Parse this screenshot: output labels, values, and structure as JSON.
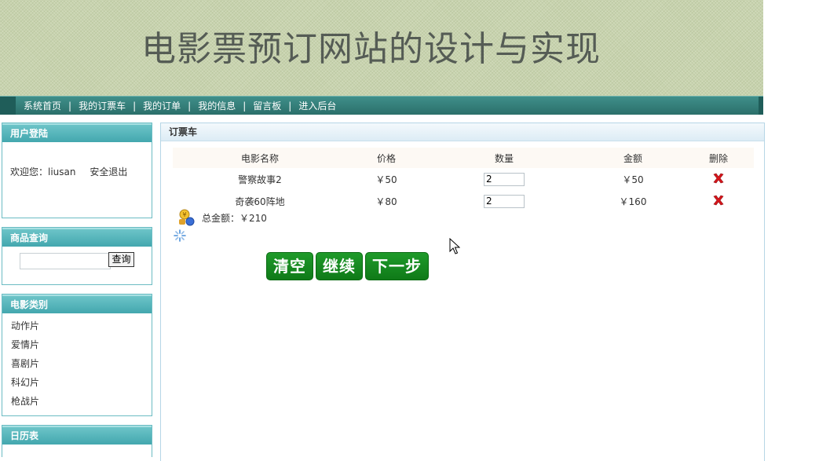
{
  "banner": {
    "title": "电影票预订网站的设计与实现"
  },
  "nav": {
    "items": [
      "系统首页",
      "我的订票车",
      "我的订单",
      "我的信息",
      "留言板",
      "进入后台"
    ],
    "separator": "|"
  },
  "sidebar": {
    "login": {
      "title": "用户登陆",
      "welcome": "欢迎您：liusan",
      "logout": "安全退出"
    },
    "search": {
      "title": "商品查询",
      "input_value": "",
      "button": "查询"
    },
    "categories": {
      "title": "电影类别",
      "items": [
        "动作片",
        "爱情片",
        "喜剧片",
        "科幻片",
        "枪战片"
      ]
    },
    "calendar": {
      "title": "日历表"
    }
  },
  "cart": {
    "title": "订票车",
    "columns": [
      "电影名称",
      "价格",
      "数量",
      "金额",
      "删除"
    ],
    "rows": [
      {
        "name": "警察故事2",
        "price": "￥50",
        "qty": "2",
        "amount": "￥50"
      },
      {
        "name": "奇袭60阵地",
        "price": "￥80",
        "qty": "2",
        "amount": "￥160"
      }
    ],
    "total": "总金额：￥210",
    "buttons": {
      "clear": "清空",
      "continue": "继续",
      "next": "下一步"
    }
  },
  "colors": {
    "nav": "#2f7a75",
    "sidebar_head": "#4fb0b6",
    "button_green": "#178a22",
    "delete_red": "#d8151b"
  }
}
